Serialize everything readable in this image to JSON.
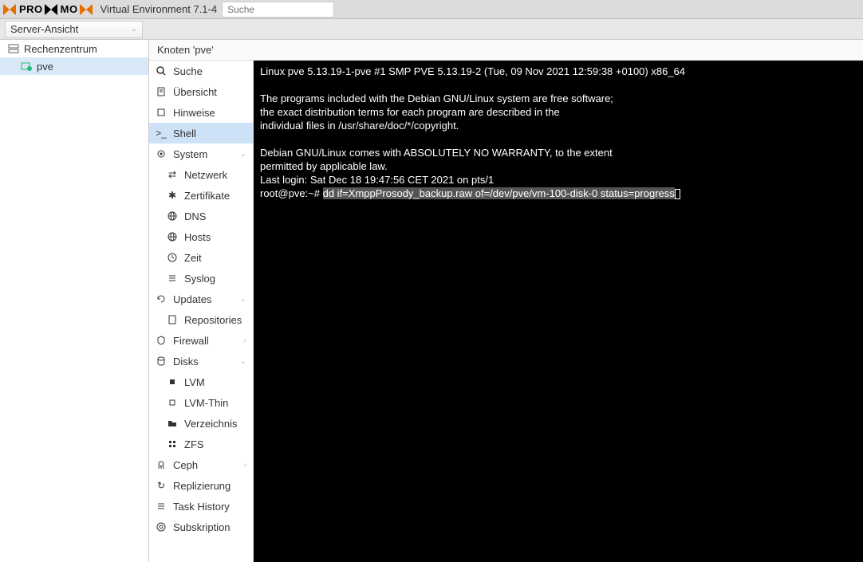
{
  "header": {
    "logo_text_1": "PRO",
    "logo_text_2": "MO",
    "env": "Virtual Environment 7.1-4",
    "search_placeholder": "Suche"
  },
  "viewbar": {
    "selector": "Server-Ansicht"
  },
  "tree": {
    "root": "Rechenzentrum",
    "node": "pve"
  },
  "crumb": "Knoten 'pve'",
  "menu": {
    "search": "Suche",
    "summary": "Übersicht",
    "notes": "Hinweise",
    "shell": "Shell",
    "system": "System",
    "network": "Netzwerk",
    "certs": "Zertifikate",
    "dns": "DNS",
    "hosts": "Hosts",
    "time": "Zeit",
    "syslog": "Syslog",
    "updates": "Updates",
    "repos": "Repositories",
    "firewall": "Firewall",
    "disks": "Disks",
    "lvm": "LVM",
    "lvmthin": "LVM-Thin",
    "dir": "Verzeichnis",
    "zfs": "ZFS",
    "ceph": "Ceph",
    "repl": "Replizierung",
    "taskhist": "Task History",
    "sub": "Subskription"
  },
  "terminal": {
    "l1": "Linux pve 5.13.19-1-pve #1 SMP PVE 5.13.19-2 (Tue, 09 Nov 2021 12:59:38 +0100) x86_64",
    "l2": "",
    "l3": "The programs included with the Debian GNU/Linux system are free software;",
    "l4": "the exact distribution terms for each program are described in the",
    "l5": "individual files in /usr/share/doc/*/copyright.",
    "l6": "",
    "l7": "Debian GNU/Linux comes with ABSOLUTELY NO WARRANTY, to the extent",
    "l8": "permitted by applicable law.",
    "l9": "Last login: Sat Dec 18 19:47:56 CET 2021 on pts/1",
    "prompt": "root@pve:~# ",
    "cmd": "dd if=XmppProsody_backup.raw of=/dev/pve/vm-100-disk-0 status=progress"
  }
}
